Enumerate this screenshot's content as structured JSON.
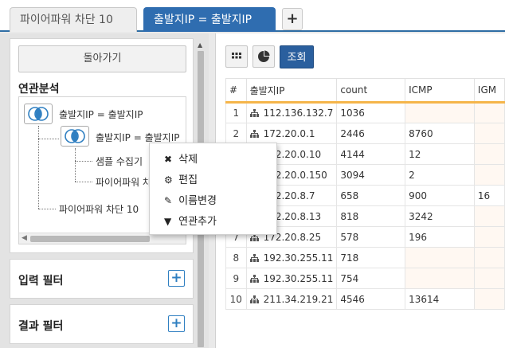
{
  "tabs": [
    {
      "label": "파이어파워 차단 10",
      "active": false
    },
    {
      "label": "출발지IP = 출발지IP",
      "active": true
    }
  ],
  "tab_add_label": "+",
  "left": {
    "back_button": "돌아가기",
    "analysis_title": "연관분석",
    "tree": {
      "root": "출발지IP = 출발지IP",
      "child": "출발지IP = 출발지IP",
      "grandchild1": "샘플 수집기",
      "grandchild2": "파이어파워 차",
      "sibling": "파이어파워 차단 10"
    },
    "input_filter": "입력 필터",
    "result_filter": "결과 필터"
  },
  "context_menu": [
    {
      "icon": "close-icon",
      "glyph": "✖",
      "label": "삭제"
    },
    {
      "icon": "gear-icon",
      "glyph": "⚙",
      "label": "편집"
    },
    {
      "icon": "pencil-icon",
      "glyph": "✎",
      "label": "이름변경"
    },
    {
      "icon": "filter-icon",
      "glyph": "▼",
      "label": "연관추가"
    }
  ],
  "toolbar": {
    "query_button": "조회"
  },
  "table": {
    "columns": [
      "#",
      "출발지IP",
      "count",
      "ICMP",
      "IGM"
    ],
    "rows": [
      [
        "1",
        "112.136.132.7",
        "1036",
        "",
        ""
      ],
      [
        "2",
        "172.20.0.1",
        "2446",
        "8760",
        ""
      ],
      [
        "3",
        "172.20.0.10",
        "4144",
        "12",
        ""
      ],
      [
        "4",
        "172.20.0.150",
        "3094",
        "2",
        ""
      ],
      [
        "5",
        "172.20.8.7",
        "658",
        "900",
        "16"
      ],
      [
        "6",
        "172.20.8.13",
        "818",
        "3242",
        ""
      ],
      [
        "7",
        "172.20.8.25",
        "578",
        "196",
        ""
      ],
      [
        "8",
        "192.30.255.11",
        "718",
        "",
        ""
      ],
      [
        "9",
        "192.30.255.11",
        "754",
        "",
        ""
      ],
      [
        "10",
        "211.34.219.21",
        "4546",
        "13614",
        ""
      ]
    ]
  },
  "colors": {
    "accent": "#2f6db0",
    "header_underline": "#f5b54a",
    "query_button": "#2a5f9e"
  }
}
